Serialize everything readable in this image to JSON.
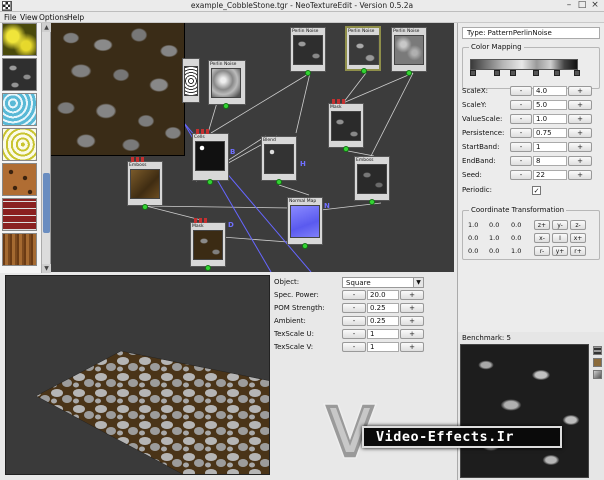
{
  "window": {
    "title": "example_CobbleStone.tgr - NeoTextureEdit - Version 0.5.2a",
    "minimize": "–",
    "maximize": "□",
    "close": "×"
  },
  "menu": {
    "file": "File",
    "view": "View",
    "options": "Options",
    "help": "Help"
  },
  "library": {
    "items": [
      "yellow-noise",
      "stone",
      "cyan-cells",
      "yellow-cells",
      "leather",
      "bricks",
      "wood"
    ],
    "scroll_up": "▲",
    "scroll_down": "▼"
  },
  "graph": {
    "nodes": [
      {
        "id": "perlin-1",
        "label": "Perlin Noise"
      },
      {
        "id": "perlin-2",
        "label": "Perlin Noise"
      },
      {
        "id": "perlin-3",
        "label": "Perlin Noise"
      },
      {
        "id": "perlin-4",
        "label": "Perlin Noise"
      },
      {
        "id": "mask-1",
        "label": "Mask"
      },
      {
        "id": "cells",
        "label": "Cells"
      },
      {
        "id": "blend",
        "label": "Blend"
      },
      {
        "id": "emboss-1",
        "label": "Emboss"
      },
      {
        "id": "emboss-2",
        "label": "Emboss"
      },
      {
        "id": "normal-map",
        "label": "Normal Map"
      },
      {
        "id": "mask-2",
        "label": "Mask"
      }
    ],
    "wire_labels": [
      "B",
      "H",
      "N",
      "D"
    ]
  },
  "properties": {
    "type_label": "Type: PatternPerlinNoise",
    "color_mapping_title": "Color Mapping",
    "minus": "-",
    "plus": "+",
    "params": [
      {
        "label": "ScaleX:",
        "value": "4.0"
      },
      {
        "label": "ScaleY:",
        "value": "5.0"
      },
      {
        "label": "ValueScale:",
        "value": "1.0"
      },
      {
        "label": "Persistence:",
        "value": "0.75"
      },
      {
        "label": "StartBand:",
        "value": "1"
      },
      {
        "label": "EndBand:",
        "value": "8"
      },
      {
        "label": "Seed:",
        "value": "22"
      }
    ],
    "periodic_label": "Periodic:",
    "periodic_checked": "✓",
    "coord_title": "Coordinate Transformation",
    "matrix": [
      [
        "1.0",
        "0.0",
        "0.0"
      ],
      [
        "0.0",
        "1.0",
        "0.0"
      ],
      [
        "0.0",
        "0.0",
        "1.0"
      ]
    ],
    "matrix_buttons": [
      [
        "z+",
        "y-",
        "z-"
      ],
      [
        "x-",
        "I",
        "x+"
      ],
      [
        "r-",
        "y+",
        "r+"
      ]
    ]
  },
  "material": {
    "object_label": "Object:",
    "object_value": "Square",
    "combo_arrow": "▼",
    "minus": "-",
    "plus": "+",
    "params": [
      {
        "label": "Spec. Power:",
        "value": "20.0"
      },
      {
        "label": "POM Strength:",
        "value": "0.25"
      },
      {
        "label": "Ambient:",
        "value": "0.25"
      },
      {
        "label": "TexScale U:",
        "value": "1"
      },
      {
        "label": "TexScale V:",
        "value": "1"
      }
    ]
  },
  "benchmark": {
    "label": "Benchmark: 5"
  },
  "watermark": {
    "text": "Video-Effects.Ir"
  }
}
